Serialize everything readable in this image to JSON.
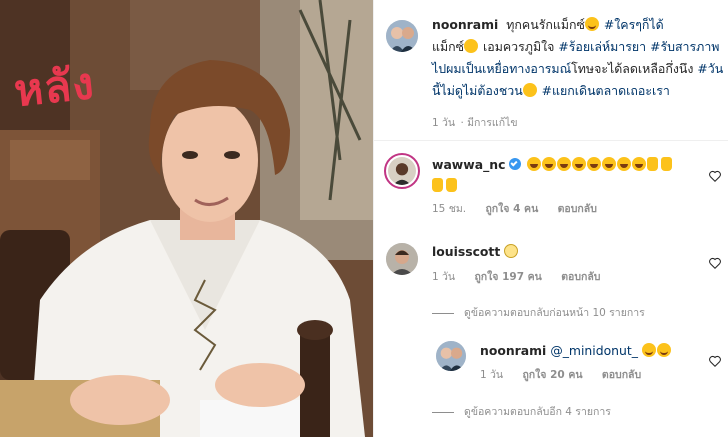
{
  "photo": {
    "overlay_text": "หลัง"
  },
  "post": {
    "username": "noonrami",
    "caption_lines": [
      {
        "text": "ทุกคนรักแม็กซ์",
        "tags": [
          "#ใครๆก็ได้"
        ]
      },
      {
        "text": "แม็กซ์",
        "tags": []
      },
      {
        "text": "เอมควรภูมิใจ",
        "tags": [
          "#ร้อยเล่ห์มารยา",
          "#รับ"
        ]
      }
    ],
    "caption_full": [
      "ทุกคนรักแม็กซ์",
      "#ใครๆก็ได้",
      "แม็กซ์",
      "เอมควรภูมิใจ",
      "#ร้อยเล่ห์มารยา",
      "#รับสารภาพไปผมเป็นเหยื่อทางอารมณ์",
      "โทษจะได้ลดเหลือกึ่งนึง",
      "#วันนี้ไม่ดูไม่ต้องชวน",
      "#แยกเดินตลาดเถอะเรา"
    ],
    "time": "1 วัน",
    "edited": "· มีการแก้ไข"
  },
  "comments": [
    {
      "username": "wawwa_nc",
      "verified": true,
      "time": "15 ชม.",
      "likes": "ถูกใจ 4 คน",
      "reply": "ตอบกลับ"
    },
    {
      "username": "louisscott",
      "time": "1 วัน",
      "likes": "ถูกใจ 197 คน",
      "reply": "ตอบกลับ",
      "view_replies": "ดูข้อความตอบกลับก่อนหน้า 10 รายการ"
    },
    {
      "username": "noonrami",
      "mention": "@_minidonut_",
      "time": "1 วัน",
      "likes": "ถูกใจ 20 คน",
      "reply": "ตอบกลับ",
      "view_replies": "ดูข้อความตอบกลับอีก 4 รายการ"
    }
  ],
  "colors": {
    "hashtag": "#003569",
    "meta": "#8e8e8e",
    "verified": "#3897f0",
    "overlay": "#e8384f"
  }
}
